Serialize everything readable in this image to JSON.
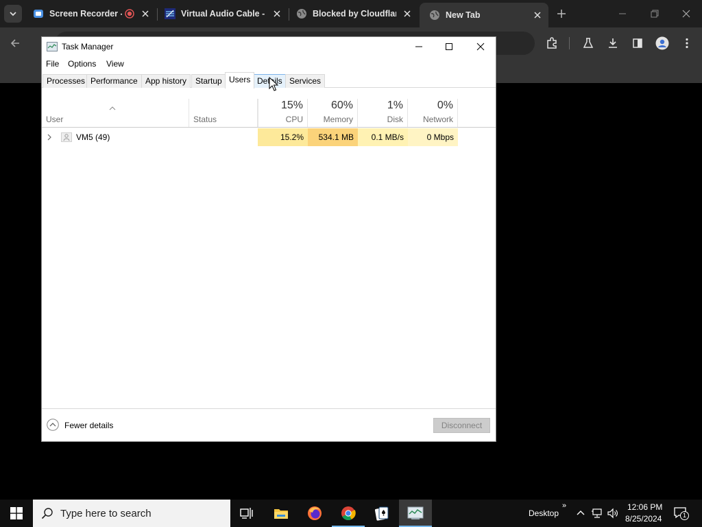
{
  "chrome": {
    "tabs": [
      {
        "title": "Screen Recorder -",
        "icon": "screen-recorder-icon"
      },
      {
        "title": "Virtual Audio Cable -",
        "icon": "virtual-audio-cable-icon"
      },
      {
        "title": "Blocked by Cloudflare",
        "icon": "globe-icon"
      },
      {
        "title": "New Tab",
        "icon": "globe-icon"
      }
    ],
    "toolbar_icons": [
      "back-icon",
      "forward-icon",
      "extensions-icon",
      "labs-icon",
      "download-icon",
      "side-panel-icon",
      "profile-icon",
      "more-icon"
    ]
  },
  "taskmanager": {
    "title": "Task Manager",
    "menu": [
      "File",
      "Options",
      "View"
    ],
    "tabs": [
      "Processes",
      "Performance",
      "App history",
      "Startup",
      "Users",
      "Details",
      "Services"
    ],
    "active_tab": "Users",
    "columns": {
      "user": "User",
      "status": "Status",
      "cpu": {
        "percent": "15%",
        "label": "CPU"
      },
      "memory": {
        "percent": "60%",
        "label": "Memory"
      },
      "disk": {
        "percent": "1%",
        "label": "Disk"
      },
      "network": {
        "percent": "0%",
        "label": "Network"
      }
    },
    "rows": [
      {
        "user": "VM5 (49)",
        "status": "",
        "cpu": "15.2%",
        "memory": "534.1 MB",
        "disk": "0.1 MB/s",
        "network": "0 Mbps"
      }
    ],
    "footer": {
      "fewer_details": "Fewer details",
      "disconnect": "Disconnect"
    }
  },
  "taskbar": {
    "search_placeholder": "Type here to search",
    "apps": [
      "task-view-icon",
      "file-explorer-icon",
      "firefox-icon",
      "chrome-icon",
      "solitaire-icon",
      "task-manager-icon"
    ],
    "desktop_label": "Desktop",
    "time": "12:06 PM",
    "date": "8/25/2024",
    "notification_count": "1"
  },
  "colors": {
    "heat_cpu": "#fde99a",
    "heat_memory": "#fbd37a",
    "heat_disk": "#fff2b3",
    "heat_network": "#fff4c4",
    "chrome_frame": "#1f1f1f",
    "chrome_toolbar": "#353535"
  }
}
